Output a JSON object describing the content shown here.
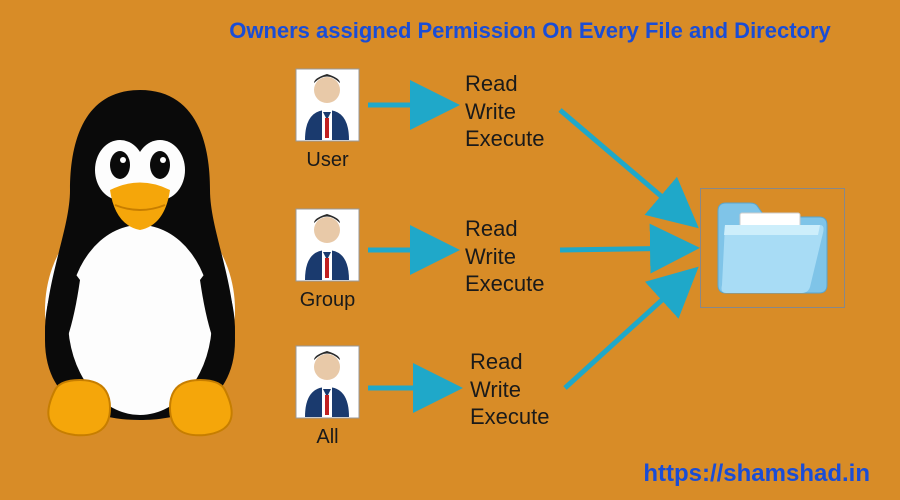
{
  "title": "Owners assigned Permission On Every File and Directory",
  "url": "https://shamshad.in",
  "owners": [
    {
      "label": "User"
    },
    {
      "label": "Group"
    },
    {
      "label": "All"
    }
  ],
  "permissions": {
    "read": "Read",
    "write": "Write",
    "execute": "Execute"
  },
  "colors": {
    "background": "#d88c27",
    "heading": "#1a4dd6",
    "arrow": "#1fa8c9"
  }
}
